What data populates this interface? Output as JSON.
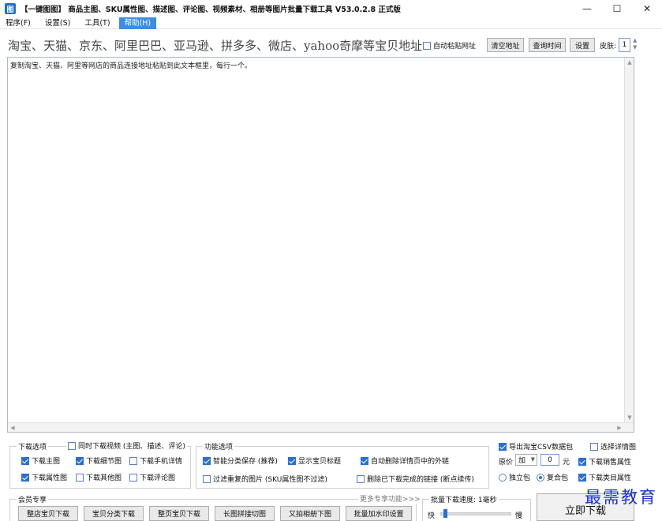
{
  "window": {
    "title": "【一键图图】 商品主图、SKU属性图、描述图、评论图、视频素材、相册等图片批量下载工具 V53.0.2.8 正式版",
    "icon_name": "app-logo-icon",
    "minimize": "—",
    "maximize": "☐",
    "close": "✕"
  },
  "menu": {
    "items": [
      {
        "label": "程序(F)"
      },
      {
        "label": "设置(S)"
      },
      {
        "label": "工具(T)"
      },
      {
        "label": "帮助(H)"
      }
    ],
    "active_index": 3
  },
  "toolbar": {
    "address_label": "淘宝、天猫、京东、阿里巴巴、亚马逊、拼多多、微店、yahoo奇摩等宝贝地址:",
    "auto_paste_label": "自动粘贴网址",
    "auto_paste_checked": false,
    "clear_button": "清空地址",
    "query_time_button": "查询时间",
    "settings_button": "设置",
    "skin_label": "皮肤:",
    "skin_value": "1"
  },
  "editor": {
    "placeholder_text": "复制淘宝、天猫、阿里等网店的商品连接地址粘贴到此文本框里，每行一个。"
  },
  "download_options": {
    "title": "下载选项",
    "video_label": "同时下载视频 (主图、描述、评论)",
    "video_checked": false,
    "items": [
      {
        "label": "下载主图",
        "checked": true
      },
      {
        "label": "下载细节图",
        "checked": true
      },
      {
        "label": "下载手机详情",
        "checked": false
      },
      {
        "label": "下载属性图",
        "checked": true
      },
      {
        "label": "下载其他图",
        "checked": false
      },
      {
        "label": "下载评论图",
        "checked": false
      }
    ]
  },
  "function_options": {
    "title": "功能选项",
    "items": [
      {
        "label": "智能分类保存 (推荐)",
        "checked": true
      },
      {
        "label": "显示宝贝标题",
        "checked": true
      },
      {
        "label": "自动删除详情页中的外链",
        "checked": true
      },
      {
        "label": "过滤重复的图片 (SKU属性图不过滤)",
        "checked": false
      },
      {
        "label": "删除已下载完成的链接 (断点续传)",
        "checked": false
      }
    ]
  },
  "right_options": {
    "export_csv_label": "导出淘宝CSV数据包",
    "export_csv_checked": true,
    "select_details_label": "选择详情图",
    "select_details_checked": false,
    "price_label": "原价",
    "price_op": "加",
    "price_value": "0",
    "price_unit": "元",
    "sales_attr_label": "下载销售属性",
    "sales_attr_checked": true,
    "category_attr_label": "下载类目属性",
    "category_attr_checked": true,
    "single_pack_label": "独立包",
    "single_pack_checked": false,
    "combined_pack_label": "复合包",
    "combined_pack_checked": true
  },
  "member": {
    "title": "会员专享",
    "more_link": "更多专享功能>>>",
    "buttons": [
      {
        "label": "整店宝贝下载"
      },
      {
        "label": "宝贝分类下载"
      },
      {
        "label": "整页宝贝下载"
      },
      {
        "label": "长图拼接切图"
      },
      {
        "label": "又拍相册下图"
      },
      {
        "label": "批量加水印设置"
      }
    ]
  },
  "speed": {
    "title": "批量下载速度: 1毫秒",
    "fast_label": "快",
    "slow_label": "慢",
    "level": 0.05
  },
  "download_now": "立即下载",
  "watermark": "最需教育",
  "colors": {
    "accent": "#2a6fd6",
    "menu_active": "#3a8ee6",
    "watermark": "#1a34c8"
  }
}
